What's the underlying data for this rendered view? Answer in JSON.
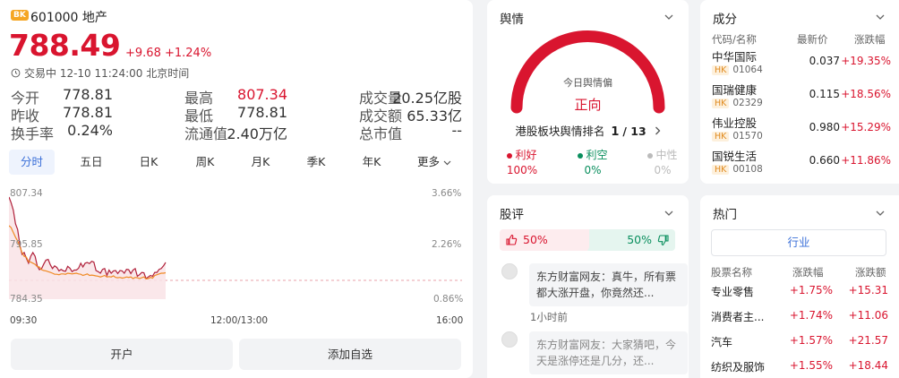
{
  "header": {
    "badge": "BK",
    "code_name": "601000 地产",
    "price": "788.49",
    "change": "+9.68",
    "change_pct": "+1.24%",
    "status": "交易中 12-10 11:24:00 北京时间"
  },
  "quote": [
    {
      "label": "今开",
      "value": "778.81",
      "color": "default"
    },
    {
      "label": "最高",
      "value": "807.34",
      "color": "red"
    },
    {
      "label": "成交量",
      "value": "20.25亿股",
      "color": "default"
    },
    {
      "label": "昨收",
      "value": "778.81",
      "color": "default"
    },
    {
      "label": "最低",
      "value": "778.81",
      "color": "default"
    },
    {
      "label": "成交额",
      "value": "65.33亿",
      "color": "default"
    },
    {
      "label": "换手率",
      "value": "0.24%",
      "color": "default"
    },
    {
      "label": "流通值",
      "value": "2.40万亿",
      "color": "default"
    },
    {
      "label": "总市值",
      "value": "--",
      "color": "default"
    }
  ],
  "tabs": [
    "分时",
    "五日",
    "日K",
    "周K",
    "月K",
    "季K",
    "年K",
    "更多"
  ],
  "active_tab": "分时",
  "chart_data": {
    "type": "line",
    "y_left_ticks": [
      "807.34",
      "795.85",
      "784.35"
    ],
    "y_right_ticks": [
      "3.66%",
      "2.26%",
      "0.86%"
    ],
    "x_ticks": [
      "09:30",
      "12:00/13:00",
      "16:00"
    ],
    "prev_close": 778.81,
    "ylim": [
      778.81,
      807.34
    ],
    "series": [
      {
        "color": "#b0203a",
        "values": [
          805.5,
          804,
          802,
          798.5,
          797,
          793,
          790.5,
          791,
          789.5,
          788.2,
          790,
          791,
          790,
          787.5,
          786.5,
          786.8,
          788,
          789,
          789.2,
          787.8,
          786.8,
          787.5,
          787.1,
          786.2,
          786.6,
          786.2,
          786.1,
          787.4,
          786.9,
          786,
          786.4,
          786.4,
          786.9,
          788.2,
          787.2,
          788.2,
          788.4,
          788.1,
          788.7,
          788.5,
          786.3,
          786,
          785.6,
          786.6,
          786.8,
          785,
          786.4,
          785.6,
          786.2,
          786.3,
          785.5,
          786.3,
          786.2,
          785.6,
          786.6,
          786.5,
          785.5,
          786.4,
          786.8,
          784.8,
          785.2,
          785.8,
          785.7,
          784.2,
          784.6,
          785,
          784.8,
          785.8,
          785.8,
          786.6,
          786.8,
          787.5,
          788.4
        ]
      },
      {
        "color": "#f08a24",
        "values": [
          798,
          797.5,
          796.2,
          795,
          794,
          792.5,
          791,
          790,
          789.8,
          788.6,
          788.5,
          788.2,
          787.9,
          787.3,
          787.2,
          786.5,
          786.3,
          786.2,
          786,
          785.8,
          785.6,
          785.3,
          785.3,
          785.2,
          785.4,
          785.4,
          785.3,
          785.6,
          785.5,
          785.4,
          785.5,
          785.6,
          785.4,
          785.3,
          785,
          785.2,
          785.4,
          785,
          785.1,
          785,
          784.9,
          784.8,
          784.6,
          784.8,
          785,
          784.6,
          784.7,
          784.6,
          784.9,
          784.5,
          784.4,
          784.5,
          784.3,
          784.4,
          784.6,
          784.5,
          784.6,
          784.2,
          784.5,
          784.4,
          784.2,
          784.4,
          784.6,
          784.1,
          784.2,
          784.5,
          784.3,
          785,
          785.2,
          785.4,
          785.6,
          785.6,
          785.7
        ]
      }
    ]
  },
  "buttons": {
    "open_account": "开户",
    "add_watch": "添加自选"
  },
  "sentiment": {
    "title": "舆情",
    "today_label": "今日舆情偏",
    "today_value": "正向",
    "rank_label": "港股板块舆情排名",
    "rank": "1",
    "rank_total": "/ 13",
    "stats": [
      {
        "label": "利好",
        "value": "100%",
        "color": "#d9152f"
      },
      {
        "label": "利空",
        "value": "0%",
        "color": "#0a8f5e"
      },
      {
        "label": "中性",
        "value": "0%",
        "color": "#bbbbbb"
      }
    ],
    "gauge_fraction": 1.0
  },
  "guping": {
    "title": "股评",
    "bull_pct": "50%",
    "bear_pct": "50%",
    "comments": [
      {
        "text": "东方财富网友：真牛，所有票都大涨开盘，你竟然还...",
        "time": "1小时前"
      },
      {
        "text": "东方财富网友：大家猜吧，今天是涨停还是几分，还...",
        "time": ""
      }
    ]
  },
  "chengfen": {
    "title": "成分",
    "headers": [
      "代码/名称",
      "最新价",
      "涨跌幅"
    ],
    "rows": [
      {
        "name": "中华国际",
        "market": "HK",
        "code": "01064",
        "price": "0.037",
        "pct": "+19.35%"
      },
      {
        "name": "国瑞健康",
        "market": "HK",
        "code": "02329",
        "price": "0.115",
        "pct": "+18.56%"
      },
      {
        "name": "伟业控股",
        "market": "HK",
        "code": "01570",
        "price": "0.980",
        "pct": "+15.29%"
      },
      {
        "name": "国锐生活",
        "market": "HK",
        "code": "00108",
        "price": "0.660",
        "pct": "+11.86%"
      }
    ]
  },
  "remen": {
    "title": "热门",
    "industry_btn": "行业",
    "headers": [
      "股票名称",
      "涨跌幅",
      "涨跌额"
    ],
    "rows": [
      {
        "name": "专业零售",
        "pct": "+1.75%",
        "amt": "+15.31"
      },
      {
        "name": "消费者主...",
        "pct": "+1.74%",
        "amt": "+11.06"
      },
      {
        "name": "汽车",
        "pct": "+1.57%",
        "amt": "+21.57"
      },
      {
        "name": "纺织及服饰",
        "pct": "+1.55%",
        "amt": "+18.44"
      }
    ]
  }
}
